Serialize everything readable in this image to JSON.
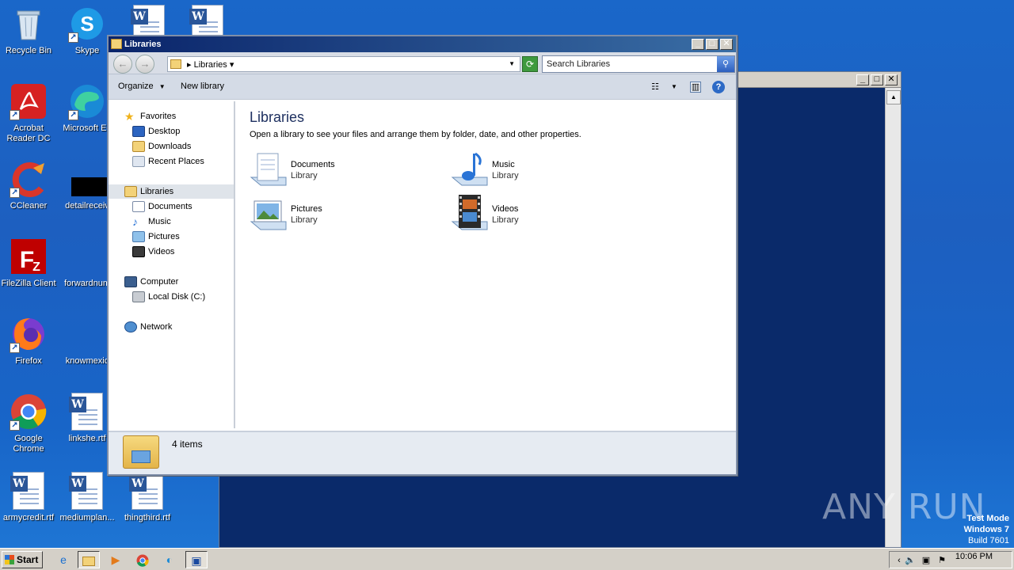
{
  "desktop": {
    "icons": [
      {
        "label": "Recycle Bin"
      },
      {
        "label": "Skype"
      },
      {
        "label": "Acrobat Reader DC"
      },
      {
        "label": "Microsoft Ed"
      },
      {
        "label": "CCleaner"
      },
      {
        "label": "detailreceiv"
      },
      {
        "label": "FileZilla Client"
      },
      {
        "label": "forwardnum"
      },
      {
        "label": "Firefox"
      },
      {
        "label": "knowmexic"
      },
      {
        "label": "Google Chrome"
      },
      {
        "label": "linkshe.rtf"
      },
      {
        "label": "armycredit.rtf"
      },
      {
        "label": "mediumplan..."
      },
      {
        "label": "thingthird.rtf"
      }
    ]
  },
  "explorer": {
    "title": "Libraries",
    "address": {
      "crumb": "Libraries"
    },
    "search": {
      "placeholder": "Search Libraries"
    },
    "commands": {
      "organize": "Organize",
      "new_library": "New library"
    },
    "nav": {
      "favorites": "Favorites",
      "desktop": "Desktop",
      "downloads": "Downloads",
      "recent": "Recent Places",
      "libraries": "Libraries",
      "documents": "Documents",
      "music": "Music",
      "pictures": "Pictures",
      "videos": "Videos",
      "computer": "Computer",
      "local_disk": "Local Disk (C:)",
      "network": "Network"
    },
    "main": {
      "heading": "Libraries",
      "subtitle": "Open a library to see your files and arrange them by folder, date, and other properties.",
      "items": [
        {
          "name": "Documents",
          "type": "Library"
        },
        {
          "name": "Music",
          "type": "Library"
        },
        {
          "name": "Pictures",
          "type": "Library"
        },
        {
          "name": "Videos",
          "type": "Library"
        }
      ]
    },
    "details": {
      "count": "4 items"
    }
  },
  "taskbar": {
    "start": "Start",
    "clock": "10:06 PM"
  },
  "watermark": "ANY RUN",
  "testmode": {
    "line1": "Test Mode",
    "line2": "Windows 7",
    "line3": "Build 7601"
  }
}
